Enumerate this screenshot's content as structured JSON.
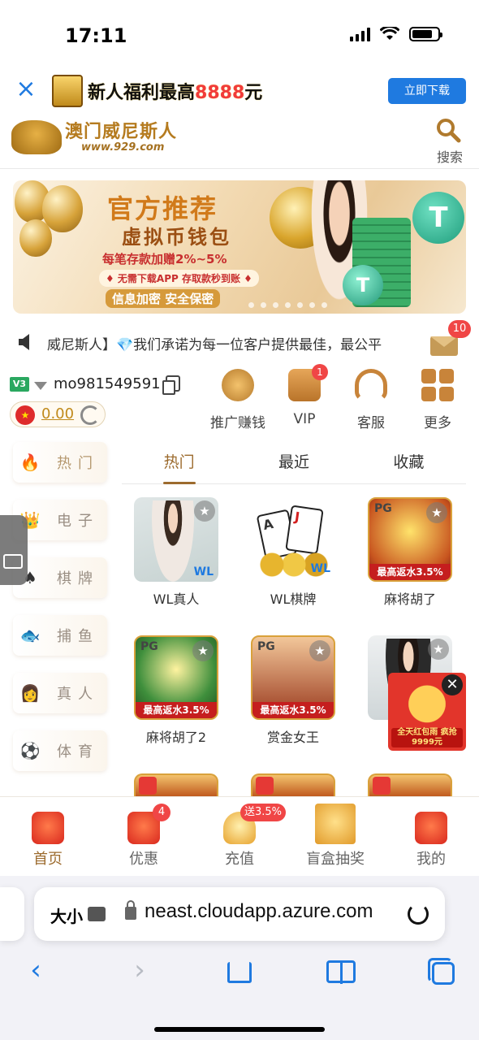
{
  "status_bar": {
    "time": "17:11"
  },
  "download_banner": {
    "close_glyph": "×",
    "text_prefix": "新人福利最高",
    "text_amount": "8888",
    "text_suffix": "元",
    "button_label": "立即下载"
  },
  "header": {
    "brand_name": "澳门威尼斯人",
    "brand_url": "www.929.com",
    "search_label": "搜索"
  },
  "promo_banner": {
    "title": "官方推荐",
    "subtitle": "虚拟币钱包",
    "line1": "每笔存款加赠2%~5%",
    "line2": "♦ 无需下载APP 存取款秒到账 ♦",
    "line3": "信息加密 安全保密",
    "tether_glyph": "T"
  },
  "marquee": {
    "text": "威尼斯人】💎我们承诺为每一位客户提供最佳，最公平",
    "mail_badge": "10"
  },
  "user": {
    "vip_level": "V3",
    "username": "mo981549591",
    "flag_glyph": "★",
    "balance": "0.00"
  },
  "quick_actions": [
    {
      "label": "推广赚钱",
      "badge": ""
    },
    {
      "label": "VIP",
      "badge": "1"
    },
    {
      "label": "客服",
      "badge": ""
    },
    {
      "label": "更多",
      "badge": ""
    }
  ],
  "categories": [
    {
      "label": "热门",
      "icon": "🔥"
    },
    {
      "label": "电子",
      "icon": "👑"
    },
    {
      "label": "棋牌",
      "icon": "♠"
    },
    {
      "label": "捕鱼",
      "icon": "🐟"
    },
    {
      "label": "真人",
      "icon": "👩"
    },
    {
      "label": "体育",
      "icon": "⚽"
    }
  ],
  "tabs": [
    "热门",
    "最近",
    "收藏"
  ],
  "games": [
    {
      "label": "WL真人",
      "rebate": ""
    },
    {
      "label": "WL棋牌",
      "rebate": ""
    },
    {
      "label": "麻将胡了",
      "rebate": "最高返水3.5%"
    },
    {
      "label": "麻将胡了2",
      "rebate": "最高返水3.5%"
    },
    {
      "label": "赏金女王",
      "rebate": "最高返水3.5%"
    }
  ],
  "game_badges": {
    "pg": "PG",
    "wl": "WL",
    "card_a": "A",
    "card_j": "J"
  },
  "float_promo": {
    "text": "全天红包雨 疯抢9999元",
    "close": "✕"
  },
  "bottom_nav": [
    {
      "label": "首页",
      "badge": ""
    },
    {
      "label": "优惠",
      "badge": "4"
    },
    {
      "label": "充值",
      "badge": "送3.5%"
    },
    {
      "label": "盲盒抽奖",
      "badge": ""
    },
    {
      "label": "我的",
      "badge": ""
    }
  ],
  "browser": {
    "aa_label": "大小",
    "url": "neast.cloudapp.azure.com",
    "back_glyph": "‹",
    "forward_glyph": "›"
  }
}
